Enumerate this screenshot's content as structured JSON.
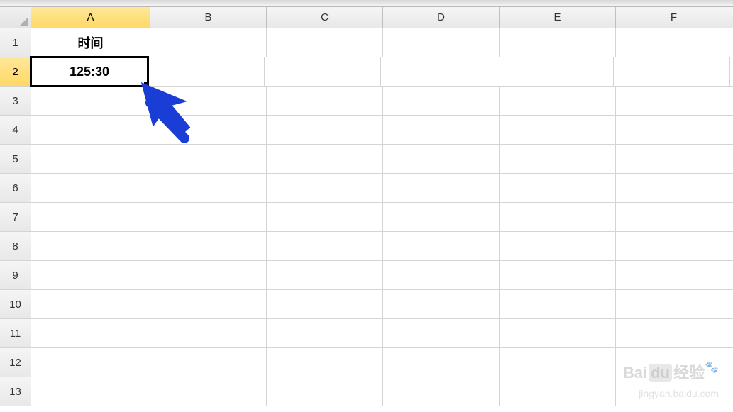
{
  "columns": [
    "A",
    "B",
    "C",
    "D",
    "E",
    "F"
  ],
  "rows": [
    "1",
    "2",
    "3",
    "4",
    "5",
    "6",
    "7",
    "8",
    "9",
    "10",
    "11",
    "12",
    "13"
  ],
  "active_column": "A",
  "active_row": "2",
  "cells": {
    "A1": "时间",
    "A2": "125:30"
  },
  "watermark": {
    "main": "Bai",
    "main2": "经验",
    "sub": "jingyan.baidu.com"
  }
}
